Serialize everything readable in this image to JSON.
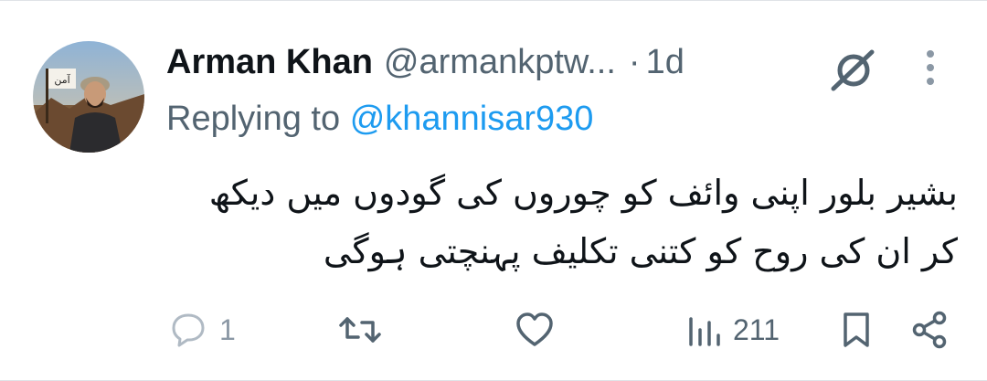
{
  "tweet": {
    "author_name": "Arman Khan",
    "author_handle": "@armankptw...",
    "separator": "·",
    "time": "1d",
    "replying_prefix": "Replying to",
    "replying_to": "@khannisar930",
    "text_line1": "بشیر بلور اپنی وائف کو چوروں کی گودوں میں دیکھ",
    "text_line2": "کر ان کی روح کو کتنی تکلیف پہنچتی ہوگی",
    "avatar_text": "آمن"
  },
  "actions": {
    "reply_count": "1",
    "retweet_count": "",
    "like_count": "",
    "views_count": "211"
  },
  "icons": {
    "grok": "grok-icon",
    "more": "more-vertical-icon",
    "reply": "reply-icon",
    "retweet": "retweet-icon",
    "like": "heart-icon",
    "views": "views-icon",
    "bookmark": "bookmark-icon",
    "share": "share-icon"
  },
  "colors": {
    "text": "#0f1419",
    "secondary": "#536471",
    "mention": "#1d9bf0",
    "reply_icon": "#8b98a5"
  }
}
